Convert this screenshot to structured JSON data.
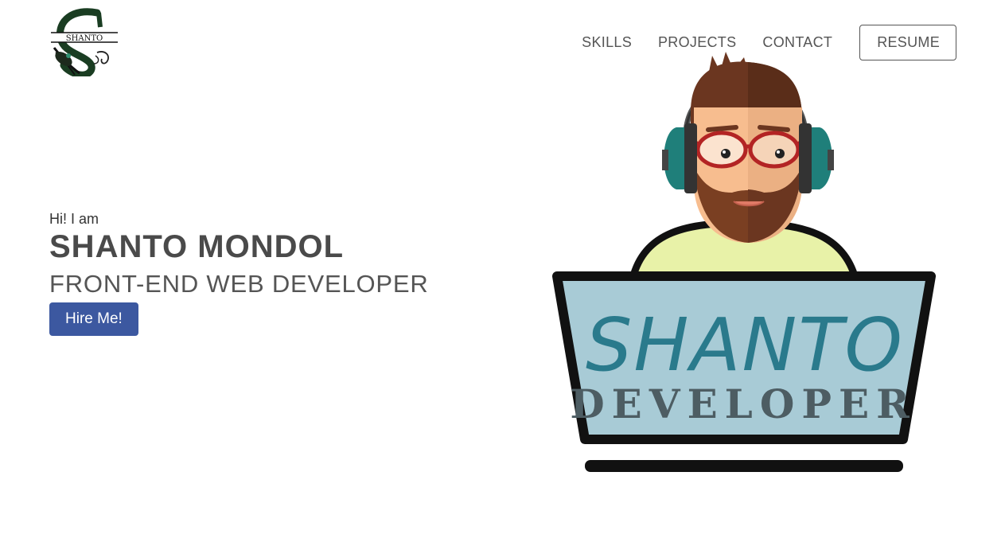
{
  "logo": {
    "text": "SHANTO"
  },
  "nav": {
    "items": [
      "SKILLS",
      "PROJECTS",
      "CONTACT"
    ],
    "resume": "RESUME"
  },
  "hero": {
    "greeting": "Hi! I am",
    "name": "SHANTO MONDOL",
    "role": "FRONT-END WEB DEVELOPER",
    "cta": "Hire Me!"
  },
  "illustration": {
    "title": "SHANTO",
    "subtitle": "DEVELOPER"
  },
  "colors": {
    "button": "#3c58a0",
    "laptop_screen": "#a8cbd6",
    "laptop_title": "#2a7a8c",
    "shirt": "#e8f2a8",
    "skin": "#f5b88a",
    "hair": "#7a3f22",
    "headphones": "#1f7f7a"
  }
}
